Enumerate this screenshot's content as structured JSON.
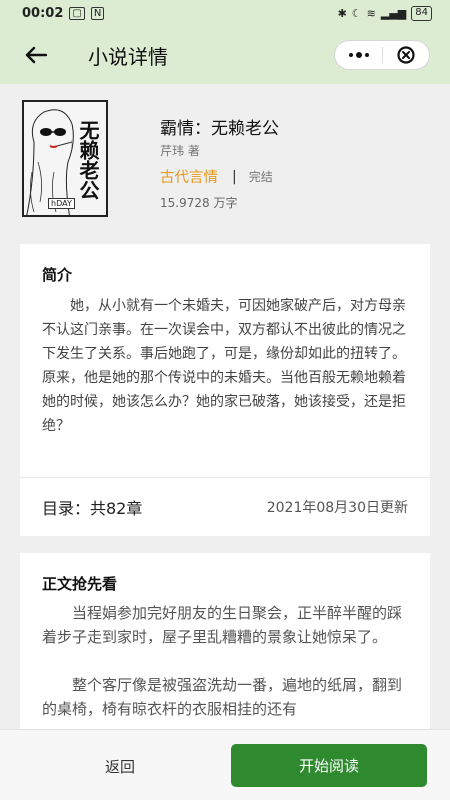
{
  "status_bar": {
    "time": "00:02",
    "battery": "84"
  },
  "header": {
    "title": "小说详情"
  },
  "book": {
    "cover_title": "无赖老公",
    "cover_stamp": "hDAY",
    "title": "霸情：无赖老公",
    "author": "芹玮 著",
    "genre": "古代言情",
    "separator": "|",
    "status": "完结",
    "word_count": "15.9728 万字"
  },
  "intro": {
    "heading": "简介",
    "text": "她，从小就有一个未婚夫，可因她家破产后，对方母亲不认这门亲事。在一次误会中，双方都认不出彼此的情况之下发生了关系。事后她跑了，可是，缘份却如此的扭转了。原来，他是她的那个传说中的未婚夫。当他百般无赖地赖着她的时候，她该怎么办？她的家已破落，她该接受，还是拒绝？"
  },
  "toc": {
    "label": "目录：共82章",
    "updated": "2021年08月30日更新"
  },
  "preview": {
    "heading": "正文抢先看",
    "paragraphs": [
      "当程娟参加完好朋友的生日聚会，正半醉半醒的踩着步子走到家时，屋子里乱糟糟的景象让她惊呆了。",
      "整个客厅像是被强盗洗劫一番，遍地的纸屑，翻到的桌椅，椅有晾衣杆的衣服相挂的还有"
    ]
  },
  "bottom": {
    "return_label": "返回",
    "read_label": "开始阅读"
  },
  "colors": {
    "header_bg": "#dcecd3",
    "accent_green": "#2f8a2f",
    "genre_orange": "#e39a1d"
  }
}
